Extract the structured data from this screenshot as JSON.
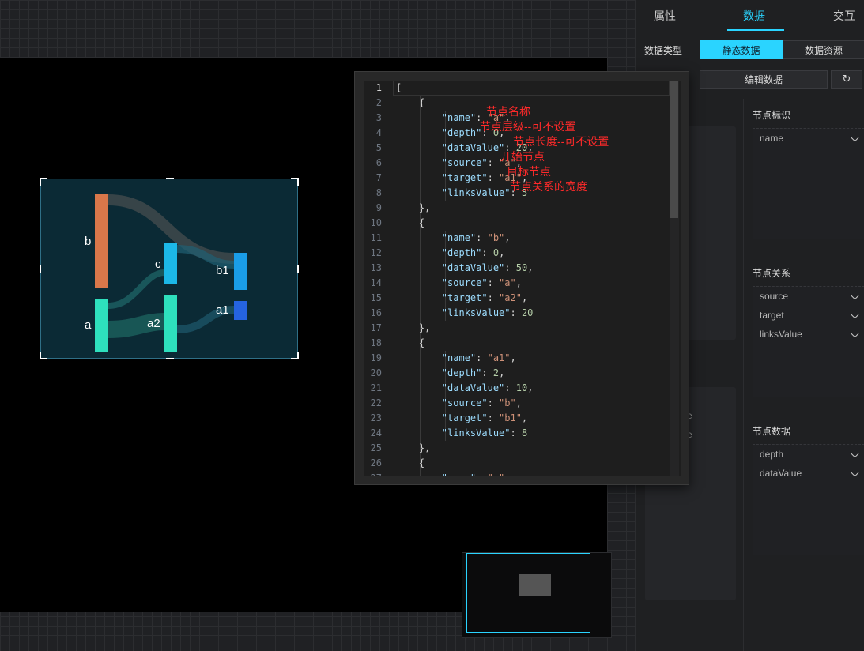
{
  "panel": {
    "tabs": [
      {
        "label": "属性",
        "active": false
      },
      {
        "label": "数据",
        "active": true
      },
      {
        "label": "交互",
        "active": false
      }
    ],
    "data_type_label": "数据类型",
    "data_type_options": [
      "静态数据",
      "数据资源"
    ],
    "data_type_selected": "静态数据",
    "edit_button": "编辑数据",
    "refresh_icon": "↻",
    "groups": [
      {
        "title": "节点标识",
        "fields": [
          "name"
        ]
      },
      {
        "title": "节点关系",
        "fields": [
          "source",
          "target",
          "linksValue"
        ]
      },
      {
        "title": "节点数据",
        "fields": [
          "depth",
          "dataValue"
        ]
      }
    ],
    "left_partial_text": [
      "e",
      "e"
    ]
  },
  "sankey": {
    "nodes": [
      {
        "name": "b",
        "depth": 0,
        "color": "#d9774a"
      },
      {
        "name": "a",
        "depth": 0,
        "color": "#2ee0bd"
      },
      {
        "name": "c",
        "depth": 1,
        "color": "#1cb8e8"
      },
      {
        "name": "a2",
        "depth": 1,
        "color": "#2ee0bd"
      },
      {
        "name": "b1",
        "depth": 2,
        "color": "#1a9de8"
      },
      {
        "name": "a1",
        "depth": 2,
        "color": "#2563e0"
      }
    ]
  },
  "editor": {
    "current_line": 1,
    "lines": [
      [
        [
          "p",
          "["
        ]
      ],
      [
        [
          "p",
          "    {"
        ]
      ],
      [
        [
          "p",
          "        "
        ],
        [
          "k",
          "\"name\""
        ],
        [
          "p",
          ": "
        ],
        [
          "s",
          "\"a\""
        ],
        [
          "p",
          ","
        ]
      ],
      [
        [
          "p",
          "        "
        ],
        [
          "k",
          "\"depth\""
        ],
        [
          "p",
          ": "
        ],
        [
          "n",
          "0"
        ],
        [
          "p",
          ","
        ]
      ],
      [
        [
          "p",
          "        "
        ],
        [
          "k",
          "\"dataValue\""
        ],
        [
          "p",
          ": "
        ],
        [
          "n",
          "20"
        ],
        [
          "p",
          ","
        ]
      ],
      [
        [
          "p",
          "        "
        ],
        [
          "k",
          "\"source\""
        ],
        [
          "p",
          ": "
        ],
        [
          "s",
          "\"a\""
        ],
        [
          "p",
          ","
        ]
      ],
      [
        [
          "p",
          "        "
        ],
        [
          "k",
          "\"target\""
        ],
        [
          "p",
          ": "
        ],
        [
          "s",
          "\"a1\""
        ],
        [
          "p",
          ","
        ]
      ],
      [
        [
          "p",
          "        "
        ],
        [
          "k",
          "\"linksValue\""
        ],
        [
          "p",
          ": "
        ],
        [
          "n",
          "5"
        ]
      ],
      [
        [
          "p",
          "    },"
        ]
      ],
      [
        [
          "p",
          "    {"
        ]
      ],
      [
        [
          "p",
          "        "
        ],
        [
          "k",
          "\"name\""
        ],
        [
          "p",
          ": "
        ],
        [
          "s",
          "\"b\""
        ],
        [
          "p",
          ","
        ]
      ],
      [
        [
          "p",
          "        "
        ],
        [
          "k",
          "\"depth\""
        ],
        [
          "p",
          ": "
        ],
        [
          "n",
          "0"
        ],
        [
          "p",
          ","
        ]
      ],
      [
        [
          "p",
          "        "
        ],
        [
          "k",
          "\"dataValue\""
        ],
        [
          "p",
          ": "
        ],
        [
          "n",
          "50"
        ],
        [
          "p",
          ","
        ]
      ],
      [
        [
          "p",
          "        "
        ],
        [
          "k",
          "\"source\""
        ],
        [
          "p",
          ": "
        ],
        [
          "s",
          "\"a\""
        ],
        [
          "p",
          ","
        ]
      ],
      [
        [
          "p",
          "        "
        ],
        [
          "k",
          "\"target\""
        ],
        [
          "p",
          ": "
        ],
        [
          "s",
          "\"a2\""
        ],
        [
          "p",
          ","
        ]
      ],
      [
        [
          "p",
          "        "
        ],
        [
          "k",
          "\"linksValue\""
        ],
        [
          "p",
          ": "
        ],
        [
          "n",
          "20"
        ]
      ],
      [
        [
          "p",
          "    },"
        ]
      ],
      [
        [
          "p",
          "    {"
        ]
      ],
      [
        [
          "p",
          "        "
        ],
        [
          "k",
          "\"name\""
        ],
        [
          "p",
          ": "
        ],
        [
          "s",
          "\"a1\""
        ],
        [
          "p",
          ","
        ]
      ],
      [
        [
          "p",
          "        "
        ],
        [
          "k",
          "\"depth\""
        ],
        [
          "p",
          ": "
        ],
        [
          "n",
          "2"
        ],
        [
          "p",
          ","
        ]
      ],
      [
        [
          "p",
          "        "
        ],
        [
          "k",
          "\"dataValue\""
        ],
        [
          "p",
          ": "
        ],
        [
          "n",
          "10"
        ],
        [
          "p",
          ","
        ]
      ],
      [
        [
          "p",
          "        "
        ],
        [
          "k",
          "\"source\""
        ],
        [
          "p",
          ": "
        ],
        [
          "s",
          "\"b\""
        ],
        [
          "p",
          ","
        ]
      ],
      [
        [
          "p",
          "        "
        ],
        [
          "k",
          "\"target\""
        ],
        [
          "p",
          ": "
        ],
        [
          "s",
          "\"b1\""
        ],
        [
          "p",
          ","
        ]
      ],
      [
        [
          "p",
          "        "
        ],
        [
          "k",
          "\"linksValue\""
        ],
        [
          "p",
          ": "
        ],
        [
          "n",
          "8"
        ]
      ],
      [
        [
          "p",
          "    },"
        ]
      ],
      [
        [
          "p",
          "    {"
        ]
      ],
      [
        [
          "p",
          "        "
        ],
        [
          "k",
          "\"name\""
        ],
        [
          "p",
          ": "
        ],
        [
          "s",
          "\"c\""
        ],
        [
          "p",
          ","
        ]
      ]
    ],
    "annotations": [
      {
        "line": 3,
        "text": "节点名称"
      },
      {
        "line": 4,
        "text": "节点层级--可不设置"
      },
      {
        "line": 5,
        "text": "节点长度--可不设置"
      },
      {
        "line": 6,
        "text": "开始节点"
      },
      {
        "line": 7,
        "text": "目标节点"
      },
      {
        "line": 8,
        "text": "节点关系的宽度"
      }
    ]
  }
}
